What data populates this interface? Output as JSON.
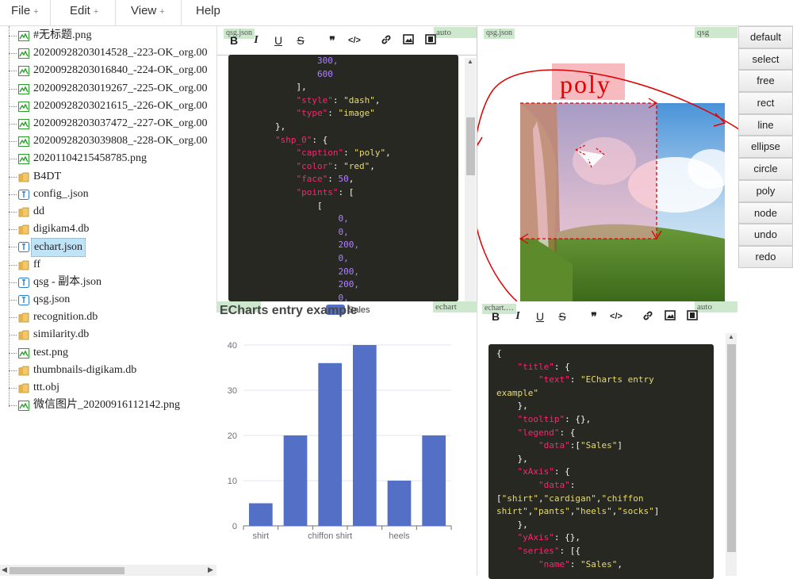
{
  "menubar": {
    "items": [
      {
        "label": "File",
        "plus": "+"
      },
      {
        "label": "Edit",
        "plus": "+"
      },
      {
        "label": "View",
        "plus": "+"
      },
      {
        "label": "Help",
        "plus": ""
      }
    ]
  },
  "tree": {
    "items": [
      {
        "label": "#无标题.png",
        "icon": "image-icon"
      },
      {
        "label": "20200928203014528_-223-OK_org.00",
        "icon": "image-icon"
      },
      {
        "label": "20200928203016840_-224-OK_org.00",
        "icon": "image-icon"
      },
      {
        "label": "20200928203019267_-225-OK_org.00",
        "icon": "image-icon"
      },
      {
        "label": "20200928203021615_-226-OK_org.00",
        "icon": "image-icon"
      },
      {
        "label": "20200928203037472_-227-OK_org.00",
        "icon": "image-icon"
      },
      {
        "label": "20200928203039808_-228-OK_org.00",
        "icon": "image-icon"
      },
      {
        "label": "20201104215458785.png",
        "icon": "image-icon"
      },
      {
        "label": "B4DT",
        "icon": "folder-icon"
      },
      {
        "label": "config_.json",
        "icon": "text-file-icon"
      },
      {
        "label": "dd",
        "icon": "folder-icon"
      },
      {
        "label": "digikam4.db",
        "icon": "folder-icon"
      },
      {
        "label": "echart.json",
        "icon": "text-file-icon",
        "selected": true
      },
      {
        "label": "ff",
        "icon": "folder-icon"
      },
      {
        "label": "qsg - 副本.json",
        "icon": "text-file-icon"
      },
      {
        "label": "qsg.json",
        "icon": "text-file-icon"
      },
      {
        "label": "recognition.db",
        "icon": "folder-icon"
      },
      {
        "label": "similarity.db",
        "icon": "folder-icon"
      },
      {
        "label": "test.png",
        "icon": "image-icon"
      },
      {
        "label": "thumbnails-digikam.db",
        "icon": "folder-icon"
      },
      {
        "label": "ttt.obj",
        "icon": "folder-icon"
      },
      {
        "label": "微信图片_20200916112142.png",
        "icon": "image-icon"
      }
    ]
  },
  "top_editor": {
    "file_tag": "qsg.json",
    "mode_tag": "auto",
    "toolbar": {
      "bold": "B",
      "italic": "I",
      "underline": "U",
      "strike": "S",
      "quote": "❞",
      "code": "</>"
    },
    "code_lines": [
      {
        "indent": "                ",
        "parts": [
          {
            "t": "n",
            "v": "300,"
          }
        ]
      },
      {
        "indent": "                ",
        "parts": [
          {
            "t": "n",
            "v": "600"
          }
        ]
      },
      {
        "indent": "            ",
        "parts": [
          {
            "t": "p",
            "v": "],"
          }
        ]
      },
      {
        "indent": "            ",
        "parts": [
          {
            "t": "k",
            "v": "\"style\""
          },
          {
            "t": "p",
            "v": ": "
          },
          {
            "t": "s",
            "v": "\"dash\""
          },
          {
            "t": "p",
            "v": ","
          }
        ]
      },
      {
        "indent": "            ",
        "parts": [
          {
            "t": "k",
            "v": "\"type\""
          },
          {
            "t": "p",
            "v": ": "
          },
          {
            "t": "s",
            "v": "\"image\""
          }
        ]
      },
      {
        "indent": "        ",
        "parts": [
          {
            "t": "p",
            "v": "},"
          }
        ]
      },
      {
        "indent": "        ",
        "parts": [
          {
            "t": "k",
            "v": "\"shp_0\""
          },
          {
            "t": "p",
            "v": ": {"
          }
        ]
      },
      {
        "indent": "            ",
        "parts": [
          {
            "t": "k",
            "v": "\"caption\""
          },
          {
            "t": "p",
            "v": ": "
          },
          {
            "t": "s",
            "v": "\"poly\""
          },
          {
            "t": "p",
            "v": ","
          }
        ]
      },
      {
        "indent": "            ",
        "parts": [
          {
            "t": "k",
            "v": "\"color\""
          },
          {
            "t": "p",
            "v": ": "
          },
          {
            "t": "s",
            "v": "\"red\""
          },
          {
            "t": "p",
            "v": ","
          }
        ]
      },
      {
        "indent": "            ",
        "parts": [
          {
            "t": "k",
            "v": "\"face\""
          },
          {
            "t": "p",
            "v": ": "
          },
          {
            "t": "n",
            "v": "50"
          },
          {
            "t": "p",
            "v": ","
          }
        ]
      },
      {
        "indent": "            ",
        "parts": [
          {
            "t": "k",
            "v": "\"points\""
          },
          {
            "t": "p",
            "v": ": ["
          }
        ]
      },
      {
        "indent": "                ",
        "parts": [
          {
            "t": "p",
            "v": "["
          }
        ]
      },
      {
        "indent": "                    ",
        "parts": [
          {
            "t": "n",
            "v": "0,"
          }
        ]
      },
      {
        "indent": "                    ",
        "parts": [
          {
            "t": "n",
            "v": "0,"
          }
        ]
      },
      {
        "indent": "                    ",
        "parts": [
          {
            "t": "n",
            "v": "200,"
          }
        ]
      },
      {
        "indent": "                    ",
        "parts": [
          {
            "t": "n",
            "v": "0,"
          }
        ]
      },
      {
        "indent": "                    ",
        "parts": [
          {
            "t": "n",
            "v": "200,"
          }
        ]
      },
      {
        "indent": "                    ",
        "parts": [
          {
            "t": "n",
            "v": "200,"
          }
        ]
      },
      {
        "indent": "                    ",
        "parts": [
          {
            "t": "n",
            "v": "0,"
          }
        ]
      }
    ]
  },
  "canvas": {
    "file_tag": "qsg.json",
    "mode_tag": "qsg",
    "shape_caption": "poly",
    "shape_color": "#e00000"
  },
  "chart_panel": {
    "file_tag": "echart",
    "legend_label": "Sales",
    "legend_color": "#5470c6"
  },
  "chart_data": {
    "type": "bar",
    "title": "ECharts entry example",
    "categories": [
      "shirt",
      "cardigan",
      "chiffon shirt",
      "pants",
      "heels",
      "socks"
    ],
    "tick_labels_shown": [
      "shirt",
      "chiffon shirt",
      "heels"
    ],
    "series": [
      {
        "name": "Sales",
        "values": [
          5,
          20,
          36,
          40,
          10,
          20
        ]
      }
    ],
    "yticks": [
      "0",
      "10",
      "20",
      "30",
      "40"
    ],
    "ylim": [
      0,
      40
    ],
    "grid": true,
    "legend": "top",
    "color": "#5470c6"
  },
  "bottom_editor": {
    "file_tag": "echart.…",
    "mode_tag": "auto",
    "toolbar": {
      "bold": "B",
      "italic": "I",
      "underline": "U",
      "strike": "S",
      "quote": "❞",
      "code": "</>"
    },
    "code_lines": [
      {
        "indent": "",
        "parts": [
          {
            "t": "p",
            "v": "{"
          }
        ]
      },
      {
        "indent": "    ",
        "parts": [
          {
            "t": "k",
            "v": "\"title\""
          },
          {
            "t": "p",
            "v": ": {"
          }
        ]
      },
      {
        "indent": "        ",
        "parts": [
          {
            "t": "k",
            "v": "\"text\""
          },
          {
            "t": "p",
            "v": ": "
          },
          {
            "t": "s",
            "v": "\"ECharts entry"
          }
        ]
      },
      {
        "indent": "",
        "parts": [
          {
            "t": "s",
            "v": "example\""
          }
        ]
      },
      {
        "indent": "    ",
        "parts": [
          {
            "t": "p",
            "v": "},"
          }
        ]
      },
      {
        "indent": "    ",
        "parts": [
          {
            "t": "k",
            "v": "\"tooltip\""
          },
          {
            "t": "p",
            "v": ": {},"
          }
        ]
      },
      {
        "indent": "    ",
        "parts": [
          {
            "t": "k",
            "v": "\"legend\""
          },
          {
            "t": "p",
            "v": ": {"
          }
        ]
      },
      {
        "indent": "        ",
        "parts": [
          {
            "t": "k",
            "v": "\"data\""
          },
          {
            "t": "p",
            "v": ":["
          },
          {
            "t": "s",
            "v": "\"Sales\""
          },
          {
            "t": "p",
            "v": "]"
          }
        ]
      },
      {
        "indent": "    ",
        "parts": [
          {
            "t": "p",
            "v": "},"
          }
        ]
      },
      {
        "indent": "    ",
        "parts": [
          {
            "t": "k",
            "v": "\"xAxis\""
          },
          {
            "t": "p",
            "v": ": {"
          }
        ]
      },
      {
        "indent": "        ",
        "parts": [
          {
            "t": "k",
            "v": "\"data\""
          },
          {
            "t": "p",
            "v": ":"
          }
        ]
      },
      {
        "indent": "",
        "parts": [
          {
            "t": "p",
            "v": "["
          },
          {
            "t": "s",
            "v": "\"shirt\""
          },
          {
            "t": "p",
            "v": ","
          },
          {
            "t": "s",
            "v": "\"cardigan\""
          },
          {
            "t": "p",
            "v": ","
          },
          {
            "t": "s",
            "v": "\"chiffon"
          }
        ]
      },
      {
        "indent": "",
        "parts": [
          {
            "t": "s",
            "v": "shirt\""
          },
          {
            "t": "p",
            "v": ","
          },
          {
            "t": "s",
            "v": "\"pants\""
          },
          {
            "t": "p",
            "v": ","
          },
          {
            "t": "s",
            "v": "\"heels\""
          },
          {
            "t": "p",
            "v": ","
          },
          {
            "t": "s",
            "v": "\"socks\""
          },
          {
            "t": "p",
            "v": "]"
          }
        ]
      },
      {
        "indent": "    ",
        "parts": [
          {
            "t": "p",
            "v": "},"
          }
        ]
      },
      {
        "indent": "    ",
        "parts": [
          {
            "t": "k",
            "v": "\"yAxis\""
          },
          {
            "t": "p",
            "v": ": {},"
          }
        ]
      },
      {
        "indent": "    ",
        "parts": [
          {
            "t": "k",
            "v": "\"series\""
          },
          {
            "t": "p",
            "v": ": [{"
          }
        ]
      },
      {
        "indent": "        ",
        "parts": [
          {
            "t": "k",
            "v": "\"name\""
          },
          {
            "t": "p",
            "v": ": "
          },
          {
            "t": "s",
            "v": "\"Sales\""
          },
          {
            "t": "p",
            "v": ","
          }
        ]
      }
    ]
  },
  "tool_buttons": [
    "default",
    "select",
    "free",
    "rect",
    "line",
    "ellipse",
    "circle",
    "poly",
    "node",
    "undo",
    "redo"
  ]
}
